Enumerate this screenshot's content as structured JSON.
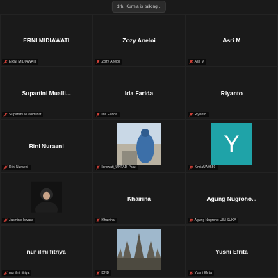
{
  "speaker_banner": "drh. Kurnia is talking...",
  "tiles": [
    {
      "name": "ERNI MIDIAWATI",
      "tag": "ERNI MIDIAWATI"
    },
    {
      "name": "Zozy Aneloi",
      "tag": "Zozy Aneloi"
    },
    {
      "name": "Asri M",
      "tag": "Asri M"
    },
    {
      "name": "Supartini  Mualli...",
      "tag": "Supartini Mualliminat"
    },
    {
      "name": "Ida Farida",
      "tag": "Ida Farida"
    },
    {
      "name": "Riyanto",
      "tag": "Riyanto"
    },
    {
      "name": "Rini Nuraeni",
      "tag": "Rini Nuraeni"
    },
    {
      "name": "",
      "tag": "Israwati_UNTAD Palu"
    },
    {
      "name": "",
      "tag": "KimiaUA9559",
      "avatar_letter": "Y"
    },
    {
      "name": "",
      "tag": "Jasmine Iswara"
    },
    {
      "name": "Khairina",
      "tag": "Khairina"
    },
    {
      "name": "Agung  Nugroho...",
      "tag": "Agung Nugroho UIN SUKA"
    },
    {
      "name": "nur ilmi fitriya",
      "tag": "nur ilmi fitriya"
    },
    {
      "name": "",
      "tag": "DND"
    },
    {
      "name": "Yusni Efrita",
      "tag": "Yusni Efrita"
    }
  ],
  "colors": {
    "background": "#1a1a1a",
    "muted_mic": "#e0453b",
    "avatar_bg": "#1fa3a8"
  },
  "icons": {
    "muted_mic": "mic-muted-icon"
  }
}
